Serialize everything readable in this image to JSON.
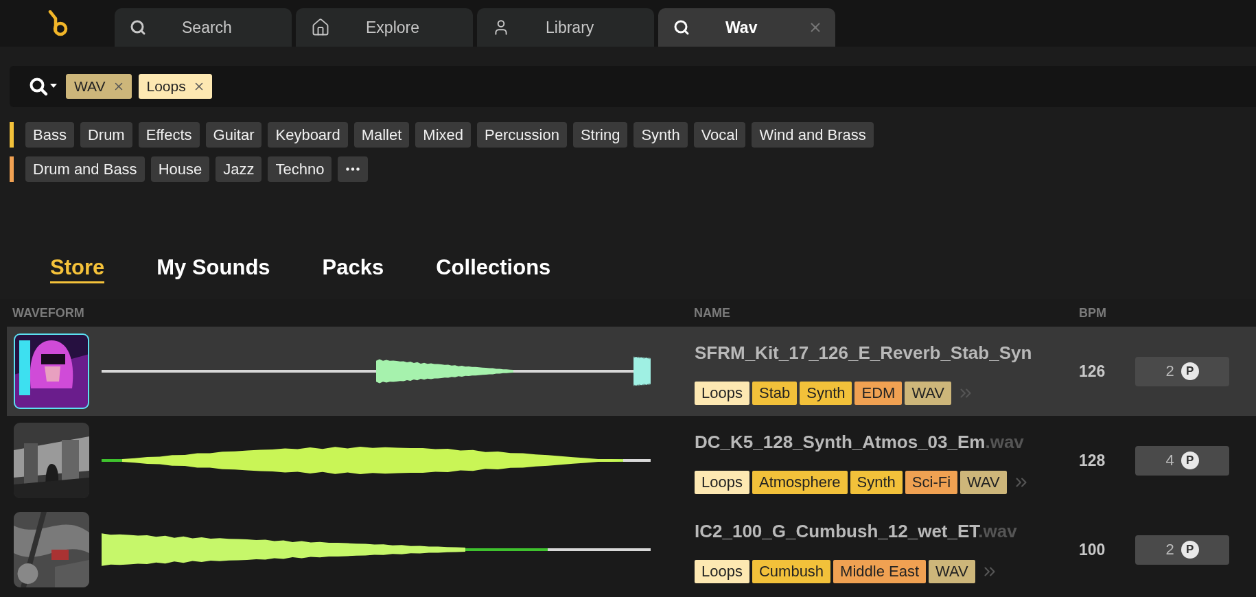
{
  "tabs": [
    {
      "label": "Search",
      "kind": "search",
      "selected": false,
      "closable": false
    },
    {
      "label": "Explore",
      "kind": "home",
      "selected": false,
      "closable": false
    },
    {
      "label": "Library",
      "kind": "user",
      "selected": false,
      "closable": false
    },
    {
      "label": "Wav",
      "kind": "search",
      "selected": true,
      "closable": true
    }
  ],
  "search": {
    "tags": [
      {
        "label": "WAV",
        "color": "#cdb67a"
      },
      {
        "label": "Loops",
        "color": "#fde8b2"
      }
    ]
  },
  "filter_groups": [
    {
      "color": "#f2c13a",
      "chips": [
        "Bass",
        "Drum",
        "Effects",
        "Guitar",
        "Keyboard",
        "Mallet",
        "Mixed",
        "Percussion",
        "String",
        "Synth",
        "Vocal",
        "Wind and Brass"
      ]
    },
    {
      "color": "#f0a152",
      "more": true,
      "chips": [
        "Drum and Bass",
        "House",
        "Jazz",
        "Techno"
      ]
    }
  ],
  "section_tabs": [
    {
      "label": "Store",
      "selected": true
    },
    {
      "label": "My Sounds",
      "selected": false
    },
    {
      "label": "Packs",
      "selected": false
    },
    {
      "label": "Collections",
      "selected": false
    }
  ],
  "table": {
    "columns": [
      "WAVEFORM",
      "NAME",
      "BPM"
    ],
    "rows": [
      {
        "selected": true,
        "thumbnail": {
          "kind": "picture"
        },
        "name": "SFRM_Kit_17_126_E_Reverb_Stab_Syn",
        "extension": "",
        "bpm": "126",
        "price": "2",
        "unit": "P",
        "tags": [
          {
            "label": "Loops",
            "color": "#fde8b2"
          },
          {
            "label": "Stab",
            "color": "#f2c13a"
          },
          {
            "label": "Synth",
            "color": "#f2c13a"
          },
          {
            "label": "EDM",
            "color": "#f0a152"
          },
          {
            "label": "WAV",
            "color": "#cdb67a"
          }
        ]
      },
      {
        "selected": false,
        "thumbnail": {
          "kind": "picture"
        },
        "name": "DC_K5_128_Synth_Atmos_03_Em",
        "extension": ".wav",
        "bpm": "128",
        "price": "4",
        "unit": "P",
        "tags": [
          {
            "label": "Loops",
            "color": "#fde8b2"
          },
          {
            "label": "Atmosphere",
            "color": "#f2c13a"
          },
          {
            "label": "Synth",
            "color": "#f2c13a"
          },
          {
            "label": "Sci-Fi",
            "color": "#f0a152"
          },
          {
            "label": "WAV",
            "color": "#cdb67a"
          }
        ]
      },
      {
        "selected": false,
        "thumbnail": {
          "kind": "picture"
        },
        "name": "IC2_100_G_Cumbush_12_wet_ET",
        "extension": ".wav",
        "bpm": "100",
        "price": "2",
        "unit": "P",
        "tags": [
          {
            "label": "Loops",
            "color": "#fde8b2"
          },
          {
            "label": "Cumbush",
            "color": "#f2c13a"
          },
          {
            "label": "Middle East",
            "color": "#f0a152"
          },
          {
            "label": "WAV",
            "color": "#cdb67a"
          }
        ]
      }
    ]
  }
}
